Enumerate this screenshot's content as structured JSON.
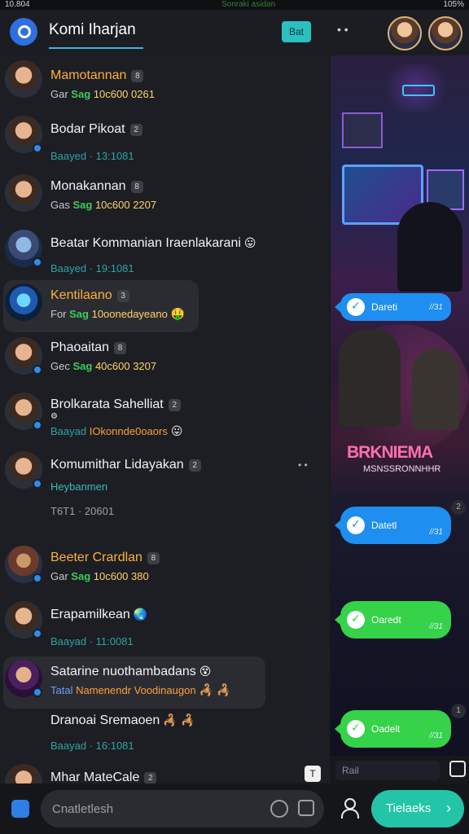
{
  "status_bar": {
    "time": "10.804",
    "center": "Sonraki asidan",
    "right": "105%"
  },
  "header": {
    "title": "Komi Iharjan",
    "button_label": "Bat"
  },
  "chats": [
    {
      "name": "Mamotannan",
      "name_color": "orange",
      "badge": "8",
      "meta_pre": "Gar",
      "meta_tag": "Sag",
      "meta_val": "10c600 0261",
      "avatar": "man",
      "verified": false
    },
    {
      "name": "Bodar Pikoat",
      "badge": "2",
      "meta_dim": "Baayed · 13:1081",
      "avatar": "man",
      "verified": true
    },
    {
      "name": "Monakannan",
      "badge": "8",
      "meta_pre": "Gas",
      "meta_tag": "Sag",
      "meta_val": "10c600 2207",
      "avatar": "man",
      "verified": false
    },
    {
      "name": "Beatar Kommanian Iraenlakarani",
      "emoji": "😛",
      "meta_dim": "Baayed · 19:1081",
      "avatar": "fantasy",
      "verified": true
    },
    {
      "name": "Kentilaano",
      "name_color": "orange",
      "badge": "3",
      "meta_pre": "For",
      "meta_tag": "Sag",
      "meta_val": "10oonedayeano",
      "emoji": "🤑",
      "avatar": "neon",
      "verified": false,
      "highlight": true
    },
    {
      "name": "Phaoaitan",
      "badge": "8",
      "meta_pre": "Gec",
      "meta_tag": "Sag",
      "meta_val": "40c600 3207",
      "avatar": "man",
      "verified": true
    },
    {
      "name": "Brolkarata Sahelliat",
      "badge": "2",
      "sub_icon": "⚙",
      "meta_pre": "Baayad",
      "meta_orange": "IOkonnde0oaors",
      "emoji": "😛",
      "avatar": "man",
      "verified": true
    },
    {
      "name": "Komumithar Lidayakan",
      "badge": "2",
      "meta_teal": "Heybanmen",
      "meta_dim": "T6T1 · 20601",
      "avatar": "man",
      "verified": true,
      "dots": "• •"
    },
    {
      "name": "Beeter Crardlan",
      "name_color": "orange",
      "badge": "8",
      "meta_pre": "Gar",
      "meta_tag": "Sag",
      "meta_val": "10c600 380",
      "avatar": "warrior",
      "verified": true
    },
    {
      "name": "Erapamilkean",
      "emoji": "🌏",
      "meta_dim": "Baayad · 11:0081",
      "avatar": "man",
      "verified": true
    },
    {
      "name": "Satarine nuothambadans",
      "emoji": "😵",
      "meta_blue": "Tatal",
      "meta_orange": "Namenendr Voodinaugon",
      "emoji2": "🦂 🦂",
      "avatar": "purple",
      "verified": true,
      "highlight": true
    },
    {
      "name": "Dranoai Sremaoen",
      "emoji": "🦂 🦂",
      "meta_dim": "Baayad · 16:1081"
    },
    {
      "name": "Mhar MateCale",
      "badge": "2",
      "avatar": "man",
      "verified": false
    }
  ],
  "messages": [
    {
      "text": "Dareti",
      "time": "//31",
      "color": "blue"
    },
    {
      "text": "Datetl",
      "time": "//31",
      "color": "blue",
      "badge": "2"
    },
    {
      "text": "Oaredt",
      "time": "//31",
      "color": "green"
    },
    {
      "text": "Oadelt",
      "time": "//31",
      "color": "green",
      "badge": "1"
    }
  ],
  "game": {
    "logo": "BRKNIEMA",
    "sub": "MSNSSRONNHHR"
  },
  "reply": {
    "placeholder": "Rail"
  },
  "float_label": "T",
  "composer": {
    "placeholder": "Cnatletlesh"
  },
  "send": {
    "label": "Tielaeks",
    "chevron": "›"
  }
}
